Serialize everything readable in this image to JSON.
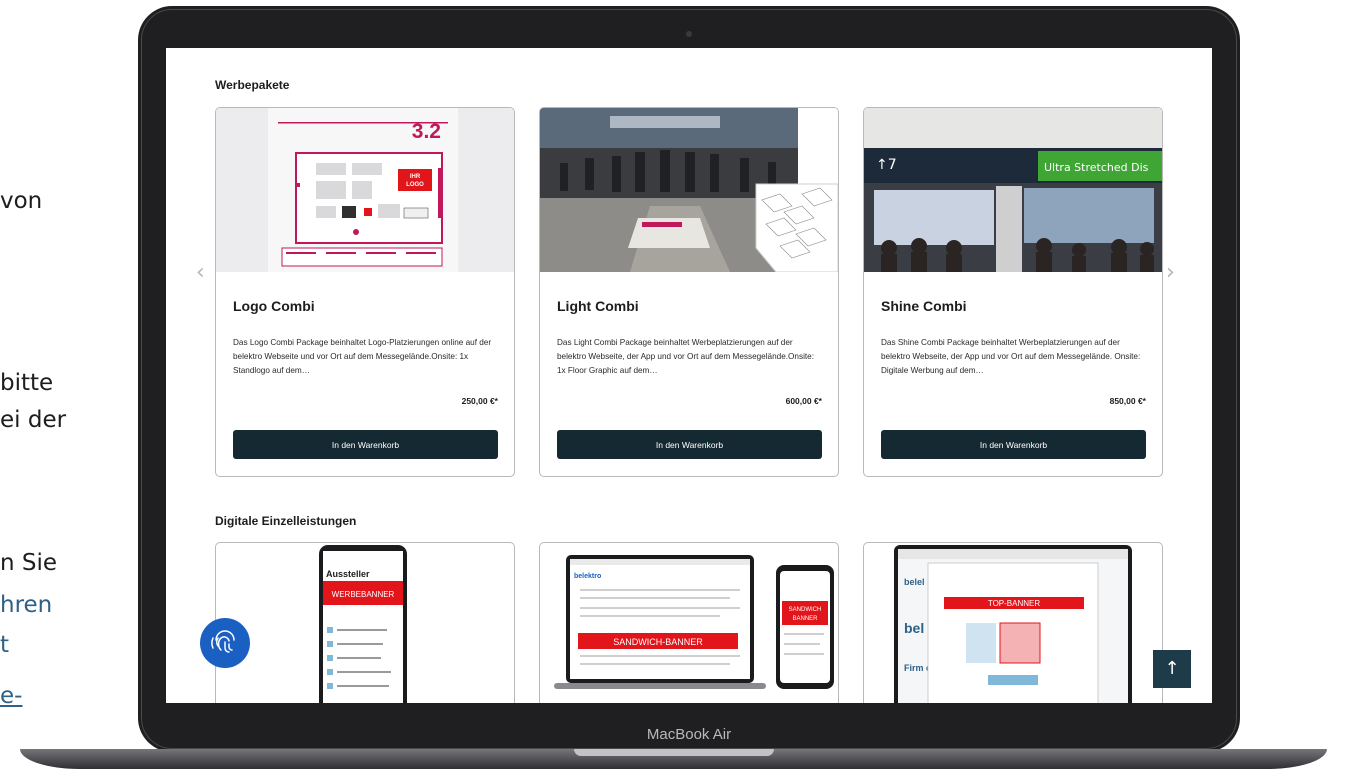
{
  "background_text": {
    "frag1": "von",
    "frag2": "bitte",
    "frag3": "ei der",
    "frag4": "n Sie",
    "frag5": "hren",
    "frag6": "t",
    "frag7": "e-"
  },
  "laptop": {
    "model_label": "MacBook Air"
  },
  "werbepakete": {
    "title": "Werbepakete",
    "cards": [
      {
        "name": "Logo Combi",
        "description": "Das Logo Combi Package beinhaltet Logo-Platzierungen online auf der belektro Webseite und vor Ort auf dem Messegelände.Onsite: 1x Standlogo auf dem…",
        "price": "250,00 €*",
        "button": "In den Warenkorb",
        "image_text": {
          "hall": "3.2",
          "logo_line1": "IHR",
          "logo_line2": "LOGO"
        }
      },
      {
        "name": "Light Combi",
        "description": "Das Light Combi Package beinhaltet Werbeplatzierungen auf der belektro Webseite, der App und vor Ort auf dem Messegelände.Onsite: 1x Floor Graphic auf dem…",
        "price": "600,00 €*",
        "button": "In den Warenkorb"
      },
      {
        "name": "Shine Combi",
        "description": "Das Shine Combi Package beinhaltet Werbeplatzierungen auf der belektro Webseite, der App und vor Ort auf dem Messegelände. Onsite: Digitale Werbung auf dem…",
        "price": "850,00 €*",
        "button": "In den Warenkorb",
        "image_text": {
          "sign": "↑7",
          "banner": "Ultra Stretched Dis"
        }
      }
    ]
  },
  "digitale": {
    "title": "Digitale Einzelleistungen",
    "cards": [
      {
        "app_heading": "Aussteller",
        "banner": "WERBEBANNER"
      },
      {
        "brand": "belektro",
        "banner": "SANDWICH-BANNER",
        "phone_banner_1": "SANDWICH",
        "phone_banner_2": "BANNER"
      },
      {
        "banner": "TOP-BANNER",
        "brand": "belel",
        "big_text": "bel Pro",
        "side_text": "Firm deta"
      }
    ]
  },
  "controls": {
    "prev_arrow": "‹",
    "next_arrow": "›",
    "scroll_top": "↑"
  },
  "colors": {
    "button_bg": "#152932",
    "accent_blue": "#1a5fc2",
    "banner_red": "#e2151b"
  }
}
